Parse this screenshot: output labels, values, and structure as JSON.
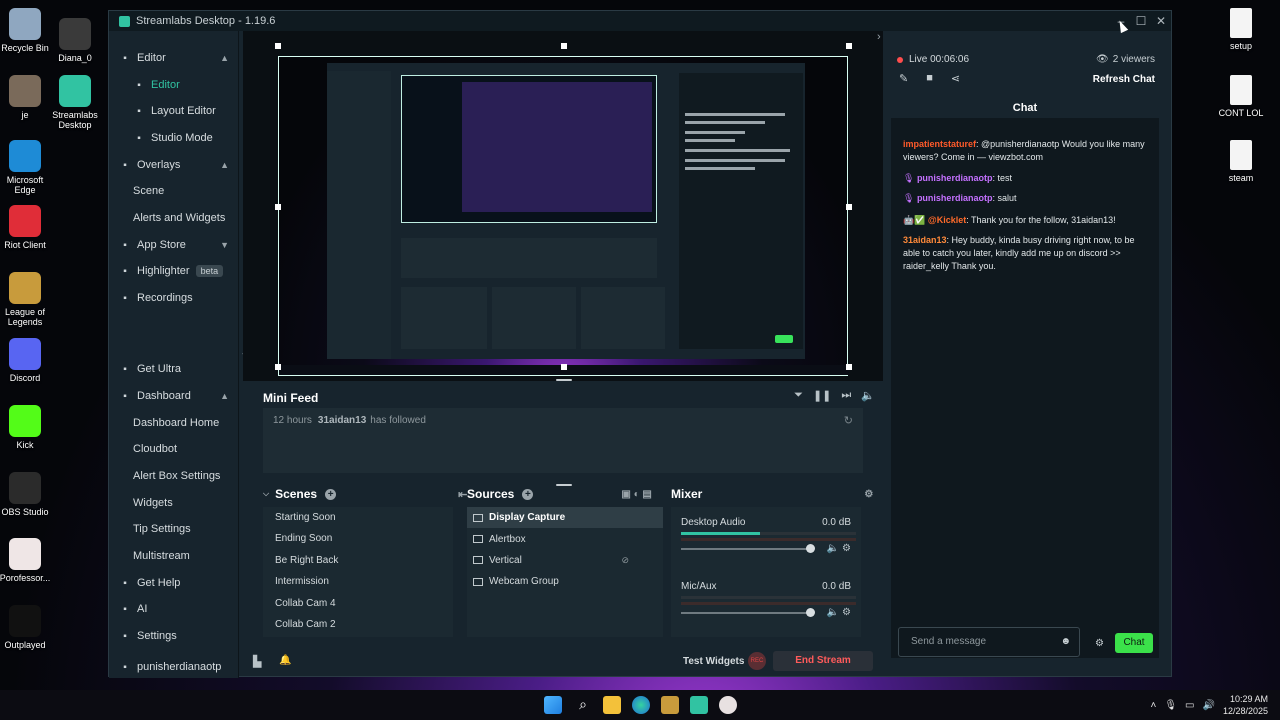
{
  "desktop": {
    "icons_left": [
      {
        "label": "Recycle Bin",
        "icon": "recycle-bin-icon"
      },
      {
        "label": "Diana_0",
        "icon": "folder-icon"
      },
      {
        "label": "je",
        "icon": "photo-icon"
      },
      {
        "label": "Streamlabs Desktop",
        "icon": "streamlabs-icon"
      },
      {
        "label": "Microsoft Edge",
        "icon": "edge-icon"
      },
      {
        "label": "Riot Client",
        "icon": "riot-icon"
      },
      {
        "label": "League of Legends",
        "icon": "league-icon"
      },
      {
        "label": "Discord",
        "icon": "discord-icon"
      },
      {
        "label": "Kick",
        "icon": "kick-icon"
      },
      {
        "label": "OBS Studio",
        "icon": "obs-icon"
      },
      {
        "label": "Porofessor...",
        "icon": "porofessor-icon"
      },
      {
        "label": "Outplayed",
        "icon": "outplayed-icon"
      }
    ],
    "icons_right": [
      {
        "label": "setup",
        "icon": "document-icon"
      },
      {
        "label": "CONT LOL",
        "icon": "document-icon"
      },
      {
        "label": "steam",
        "icon": "document-icon"
      }
    ]
  },
  "window": {
    "title": "Streamlabs Desktop - 1.19.6",
    "controls": {
      "minimize": "–",
      "maximize": "☐",
      "close": "✕"
    }
  },
  "sidebar": {
    "sections": [
      {
        "label": "Editor",
        "icon": "editor-icon",
        "chevron": "▲"
      },
      {
        "label": "Editor",
        "sub": true,
        "active": true,
        "icon": "editor-grid-icon"
      },
      {
        "label": "Layout Editor",
        "sub": true,
        "icon": "layout-icon"
      },
      {
        "label": "Studio Mode",
        "sub": true,
        "icon": "studio-icon"
      },
      {
        "label": "Overlays",
        "icon": "overlays-icon",
        "chevron": "▲"
      },
      {
        "label": "Scene",
        "sub": true
      },
      {
        "label": "Alerts and Widgets",
        "sub": true
      },
      {
        "label": "App Store",
        "icon": "app-store-icon",
        "chevron": "▼"
      },
      {
        "label": "Highlighter",
        "icon": "highlighter-icon",
        "badge": "beta"
      },
      {
        "label": "Recordings",
        "icon": "recordings-icon"
      },
      {
        "label": "Get Ultra",
        "icon": "ultra-icon"
      },
      {
        "label": "Dashboard",
        "icon": "dashboard-icon",
        "chevron": "▲"
      },
      {
        "label": "Dashboard Home",
        "sub": true
      },
      {
        "label": "Cloudbot",
        "sub": true
      },
      {
        "label": "Alert Box Settings",
        "sub": true
      },
      {
        "label": "Widgets",
        "sub": true
      },
      {
        "label": "Tip Settings",
        "sub": true
      },
      {
        "label": "Multistream",
        "sub": true
      },
      {
        "label": "Get Help",
        "icon": "help-icon"
      },
      {
        "label": "AI",
        "icon": "ai-icon"
      },
      {
        "label": "Settings",
        "icon": "gear-icon"
      },
      {
        "label": "punisherdianaotp",
        "icon": "kick-icon"
      }
    ]
  },
  "mini_feed": {
    "title": "Mini Feed",
    "event": {
      "time": "12 hours",
      "user": "31aidan13",
      "action": "has followed"
    }
  },
  "scenes": {
    "title": "Scenes",
    "items": [
      "Starting Soon",
      "Ending Soon",
      "Be Right Back",
      "Intermission",
      "Collab Cam 4",
      "Collab Cam 2"
    ]
  },
  "sources": {
    "title": "Sources",
    "items": [
      {
        "label": "Display Capture",
        "icon": "monitor-icon",
        "selected": true
      },
      {
        "label": "Alertbox",
        "icon": "widget-icon"
      },
      {
        "label": "Vertical",
        "icon": "image-icon",
        "hidden_eye": true
      },
      {
        "label": "Webcam Group",
        "icon": "folder-icon"
      }
    ]
  },
  "mixer": {
    "title": "Mixer",
    "channels": [
      {
        "name": "Desktop Audio",
        "db": "0.0 dB",
        "level": 0.45,
        "volume": 1.0
      },
      {
        "name": "Mic/Aux",
        "db": "0.0 dB",
        "level": 0.0,
        "volume": 1.0
      }
    ]
  },
  "footer": {
    "test_widgets": "Test Widgets",
    "rec": "REC",
    "end_stream": "End Stream"
  },
  "stream": {
    "live": "Live 00:06:06",
    "viewers": "2 viewers",
    "refresh_chat": "Refresh Chat"
  },
  "chat": {
    "title": "Chat",
    "messages": [
      {
        "user": "impatientstaturef",
        "color": "#ff5a2a",
        "text": ": @punisherdianaotp Would you like many viewers? Come in — viewzbot.com"
      },
      {
        "user": "punisherdianaotp",
        "color": "#c471ff",
        "text": ": test",
        "badge": "mic"
      },
      {
        "user": "punisherdianaotp",
        "color": "#c471ff",
        "text": ": salut",
        "badge": "mic"
      },
      {
        "user": "@Kicklet",
        "color": "#ff6a2a",
        "text": ": Thank you for the follow, 31aidan13!",
        "badge": "bot"
      },
      {
        "user": "31aidan13",
        "color": "#ff8a3a",
        "text": ": Hey buddy, kinda busy driving right now, to be able to catch you later, kindly add me up on discord >> raider_kelly Thank you."
      }
    ],
    "input_placeholder": "Send a message",
    "send_label": "Chat"
  },
  "taskbar": {
    "time": "10:29 AM",
    "date": "12/28/2025"
  },
  "colors": {
    "accent": "#31c3a2",
    "live": "#ff4d4d",
    "chat_button": "#3be14a",
    "end_stream": "#ff5b5b"
  }
}
